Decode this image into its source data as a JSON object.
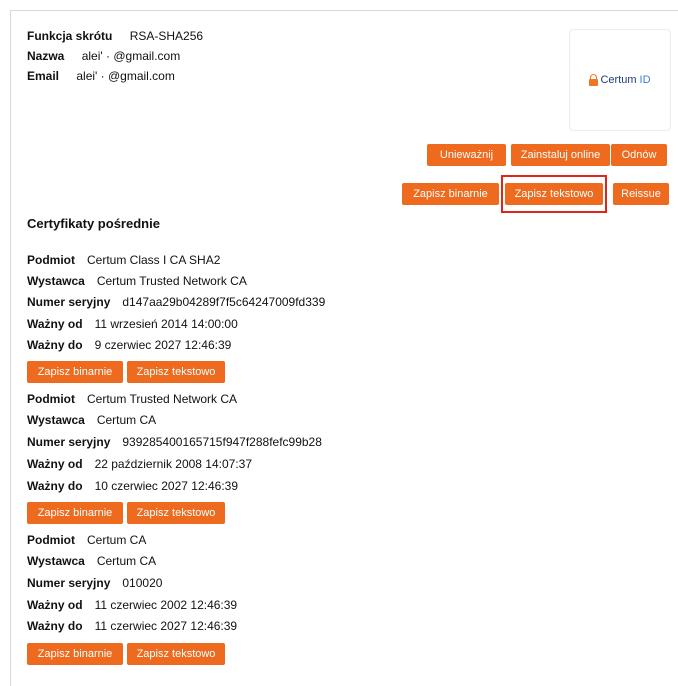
{
  "certificate": {
    "hash_label": "Funkcja skrótu",
    "hash_value": "RSA-SHA256",
    "name_label": "Nazwa",
    "name_value": "alei' · @gmail.com",
    "email_label": "Email",
    "email_value": "alei' · @gmail.com"
  },
  "logo": {
    "brand": "Certum",
    "suffix": "ID",
    "icon": "lock-icon"
  },
  "actions_row1": {
    "revoke": "Unieważnij",
    "install_online": "Zainstaluj online",
    "renew": "Odnów"
  },
  "actions_row2": {
    "save_binary": "Zapisz binarnie",
    "save_text": "Zapisz tekstowo",
    "reissue": "Reissue"
  },
  "intermediate": {
    "title": "Certyfikaty pośrednie",
    "labels": {
      "subject": "Podmiot",
      "issuer": "Wystawca",
      "serial": "Numer seryjny",
      "valid_from": "Ważny od",
      "valid_to": "Ważny do",
      "save_binary": "Zapisz binarnie",
      "save_text": "Zapisz tekstowo"
    },
    "certs": [
      {
        "subject": "Certum Class I CA SHA2",
        "issuer": "Certum Trusted Network CA",
        "serial": "d147aa29b04289f7f5c64247009fd339",
        "valid_from": "11 wrzesień 2014 14:00:00",
        "valid_to": "9 czerwiec 2027 12:46:39"
      },
      {
        "subject": "Certum Trusted Network CA",
        "issuer": "Certum CA",
        "serial": "939285400165715f947f288fefc99b28",
        "valid_from": "22 październik 2008 14:07:37",
        "valid_to": "10 czerwiec 2027 12:46:39"
      },
      {
        "subject": "Certum CA",
        "issuer": "Certum CA",
        "serial": "010020",
        "valid_from": "11 czerwiec 2002 12:46:39",
        "valid_to": "11 czerwiec 2027 12:46:39"
      }
    ]
  }
}
